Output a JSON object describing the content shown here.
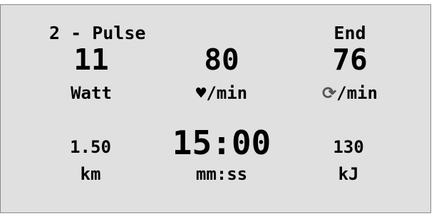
{
  "program": {
    "label": "2 - Pulse",
    "end_label": "End"
  },
  "metrics": {
    "power": {
      "value": "11",
      "unit": "Watt"
    },
    "pulse": {
      "value": "80",
      "unit_icon": "heart-icon",
      "unit_glyph": "♥",
      "unit_suffix": "/min"
    },
    "cadence": {
      "value": "76",
      "unit_icon": "rotation-icon",
      "unit_glyph": "⟳",
      "unit_suffix": "/min"
    },
    "distance": {
      "value": "1.50",
      "unit": "km"
    },
    "time": {
      "value": "15:00",
      "unit": "mm:ss"
    },
    "energy": {
      "value": "130",
      "unit": "kJ"
    }
  },
  "colors": {
    "background": "#e0e0e0",
    "text": "#000000",
    "cadence_icon": "#555555"
  }
}
